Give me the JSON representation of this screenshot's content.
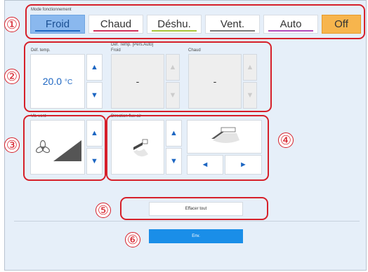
{
  "mode": {
    "label": "Mode fonctionnement",
    "buttons": [
      {
        "label": "Froid",
        "bar": "#1d66c2"
      },
      {
        "label": "Chaud",
        "bar": "#d0305a"
      },
      {
        "label": "Déshu.",
        "bar": "#a7c43a"
      },
      {
        "label": "Vent.",
        "bar": "#7a7a7a"
      },
      {
        "label": "Auto",
        "bar": "#b04ab8"
      },
      {
        "label": "Off",
        "bar": ""
      }
    ],
    "selected": "Froid"
  },
  "temp": {
    "label": "Déf. temp.",
    "value": "20.0",
    "unit": "°C",
    "auto_label_1": "Déf. Temp. [Pers.Auto]",
    "auto_label_2": "Froid",
    "auto_label_3": "Chaud",
    "froid_value": "-",
    "chaud_value": "-"
  },
  "fan": {
    "label": "Vit. vent",
    "icon": "fan-icon"
  },
  "airflow": {
    "label": "Direction flux air",
    "icon": "louver-icon"
  },
  "actions": {
    "clear_label": "Effacer tout",
    "send_label": "Env."
  },
  "arrows": {
    "up": "▲",
    "down": "▼",
    "left": "◄",
    "right": "►"
  },
  "callouts": [
    "①",
    "②",
    "③",
    "④",
    "⑤",
    "⑥"
  ],
  "colors": {
    "accent": "#1d66c2",
    "callout": "#d6202a",
    "send": "#1a8ee8",
    "off": "#f7b54d"
  }
}
